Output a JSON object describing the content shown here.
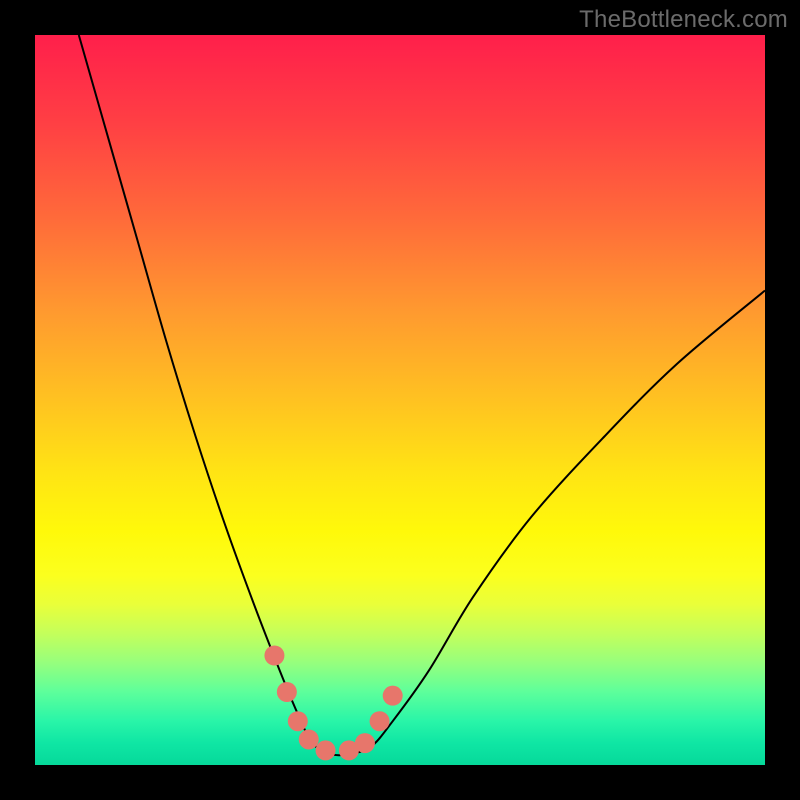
{
  "watermark": "TheBottleneck.com",
  "chart_data": {
    "type": "line",
    "title": "",
    "xlabel": "",
    "ylabel": "",
    "xlim": [
      0,
      1
    ],
    "ylim": [
      0,
      1
    ],
    "annotations": [],
    "series": [
      {
        "name": "curve",
        "x": [
          0.06,
          0.1,
          0.14,
          0.18,
          0.22,
          0.26,
          0.3,
          0.335,
          0.36,
          0.38,
          0.405,
          0.43,
          0.46,
          0.49,
          0.54,
          0.6,
          0.68,
          0.78,
          0.88,
          1.0
        ],
        "y": [
          1.0,
          0.86,
          0.72,
          0.58,
          0.45,
          0.33,
          0.22,
          0.13,
          0.07,
          0.03,
          0.015,
          0.015,
          0.025,
          0.06,
          0.13,
          0.23,
          0.34,
          0.45,
          0.55,
          0.65
        ],
        "color": "#000000"
      },
      {
        "name": "markers",
        "x": [
          0.328,
          0.345,
          0.36,
          0.375,
          0.398,
          0.43,
          0.452,
          0.472,
          0.49
        ],
        "y": [
          0.15,
          0.1,
          0.06,
          0.035,
          0.02,
          0.02,
          0.03,
          0.06,
          0.095
        ],
        "color": "#e7766b"
      }
    ]
  }
}
